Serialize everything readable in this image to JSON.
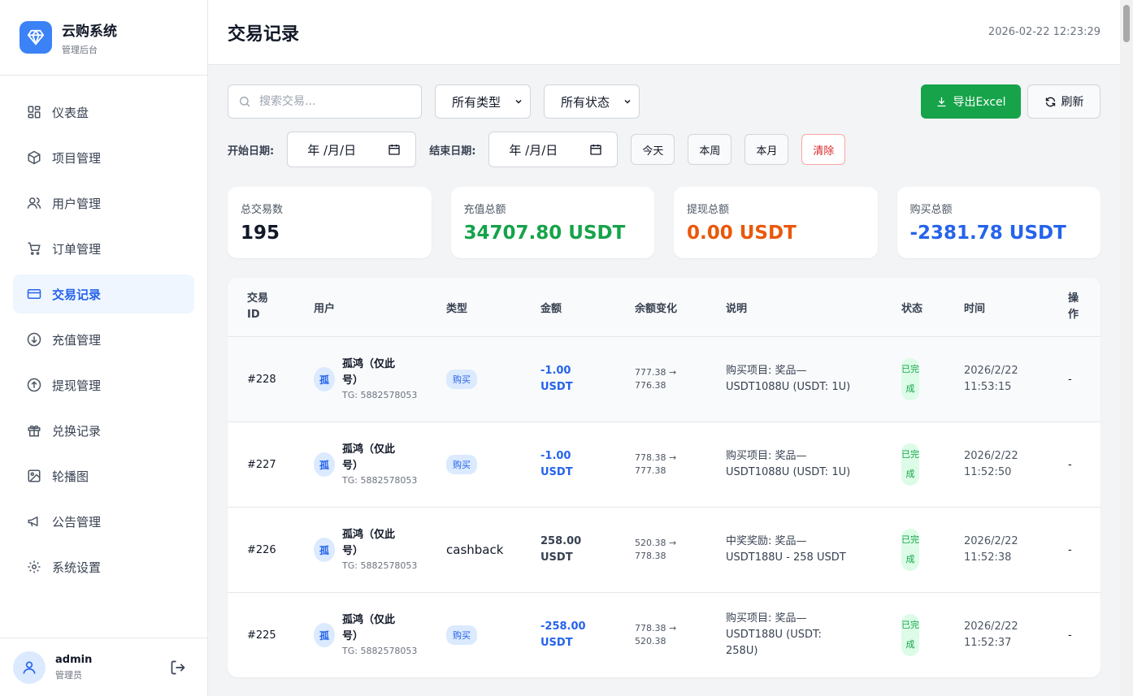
{
  "brand": {
    "title": "云购系统",
    "subtitle": "管理后台"
  },
  "nav": [
    {
      "label": "仪表盘",
      "icon": "dashboard-icon",
      "active": false
    },
    {
      "label": "项目管理",
      "icon": "box-icon",
      "active": false
    },
    {
      "label": "用户管理",
      "icon": "users-icon",
      "active": false
    },
    {
      "label": "订单管理",
      "icon": "cart-icon",
      "active": false
    },
    {
      "label": "交易记录",
      "icon": "card-icon",
      "active": true
    },
    {
      "label": "充值管理",
      "icon": "arrow-down-circle-icon",
      "active": false
    },
    {
      "label": "提现管理",
      "icon": "arrow-up-circle-icon",
      "active": false
    },
    {
      "label": "兑换记录",
      "icon": "gift-icon",
      "active": false
    },
    {
      "label": "轮播图",
      "icon": "image-icon",
      "active": false
    },
    {
      "label": "公告管理",
      "icon": "megaphone-icon",
      "active": false
    },
    {
      "label": "系统设置",
      "icon": "gear-icon",
      "active": false
    }
  ],
  "user": {
    "name": "admin",
    "role": "管理员"
  },
  "header": {
    "title": "交易记录",
    "datetime": "2026-02-22 12:23:29"
  },
  "toolbar": {
    "search_placeholder": "搜索交易...",
    "type_select": "所有类型",
    "status_select": "所有状态",
    "export_label": "导出Excel",
    "refresh_label": "刷新"
  },
  "dates": {
    "start_label": "开始日期:",
    "end_label": "结束日期:",
    "start_value": "年 /月/日",
    "end_value": "年 /月/日",
    "today": "今天",
    "week": "本周",
    "month": "本月",
    "clear": "清除"
  },
  "stats": [
    {
      "label": "总交易数",
      "value": "195",
      "color": "#111827"
    },
    {
      "label": "充值总额",
      "value": "34707.80 USDT",
      "color": "#16a34a"
    },
    {
      "label": "提现总额",
      "value": "0.00 USDT",
      "color": "#ea580c"
    },
    {
      "label": "购买总额",
      "value": "-2381.78 USDT",
      "color": "#2563eb"
    }
  ],
  "table": {
    "headers": [
      "交易\nID",
      "用户",
      "类型",
      "金额",
      "余额变化",
      "说明",
      "状态",
      "时间",
      "操\n作"
    ],
    "rows": [
      {
        "id": "#228",
        "avatar": "孤",
        "user": "孤鸿（仅此号）",
        "tg": "TG: 5882578053",
        "type": "购买",
        "type_badge": true,
        "amount": "-1.00 USDT",
        "amount_neg": true,
        "balance": "777.38 → 776.38",
        "desc": "购买项目: 奖品—USDT1088U (USDT: 1U)",
        "status": "已完成",
        "time": "2026/2/22 11:53:15",
        "op": "-"
      },
      {
        "id": "#227",
        "avatar": "孤",
        "user": "孤鸿（仅此号）",
        "tg": "TG: 5882578053",
        "type": "购买",
        "type_badge": true,
        "amount": "-1.00 USDT",
        "amount_neg": true,
        "balance": "778.38 → 777.38",
        "desc": "购买项目: 奖品—USDT1088U (USDT: 1U)",
        "status": "已完成",
        "time": "2026/2/22 11:52:50",
        "op": "-"
      },
      {
        "id": "#226",
        "avatar": "孤",
        "user": "孤鸿（仅此号）",
        "tg": "TG: 5882578053",
        "type": "cashback",
        "type_badge": false,
        "amount": "258.00 USDT",
        "amount_neg": false,
        "balance": "520.38 → 778.38",
        "desc": "中奖奖励: 奖品—USDT188U - 258 USDT",
        "status": "已完成",
        "time": "2026/2/22 11:52:38",
        "op": "-"
      },
      {
        "id": "#225",
        "avatar": "孤",
        "user": "孤鸿（仅此号）",
        "tg": "TG: 5882578053",
        "type": "购买",
        "type_badge": true,
        "amount": "-258.00 USDT",
        "amount_neg": true,
        "balance": "778.38 → 520.38",
        "desc": "购买项目: 奖品—USDT188U (USDT: 258U)",
        "status": "已完成",
        "time": "2026/2/22 11:52:37",
        "op": "-"
      }
    ]
  }
}
